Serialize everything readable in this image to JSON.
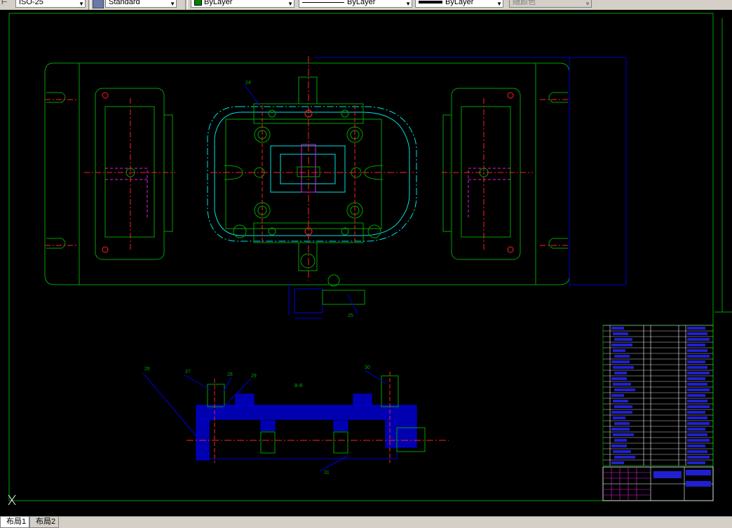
{
  "toolbar": {
    "dim_style": "ISO-25",
    "text_style": "Standard",
    "layer_color": "ByLayer",
    "linetype": "ByLayer",
    "lineweight": "ByLayer",
    "plot_style": "随颜色",
    "colors": {
      "layer_swatch": "#008000"
    }
  },
  "drawing": {
    "section_label": "B-B",
    "callouts": [
      "24",
      "25",
      "26",
      "27",
      "28",
      "29",
      "30",
      "31"
    ]
  },
  "tabs": [
    "布局1",
    "布局2"
  ],
  "ucs_icon": "ucs-icon"
}
